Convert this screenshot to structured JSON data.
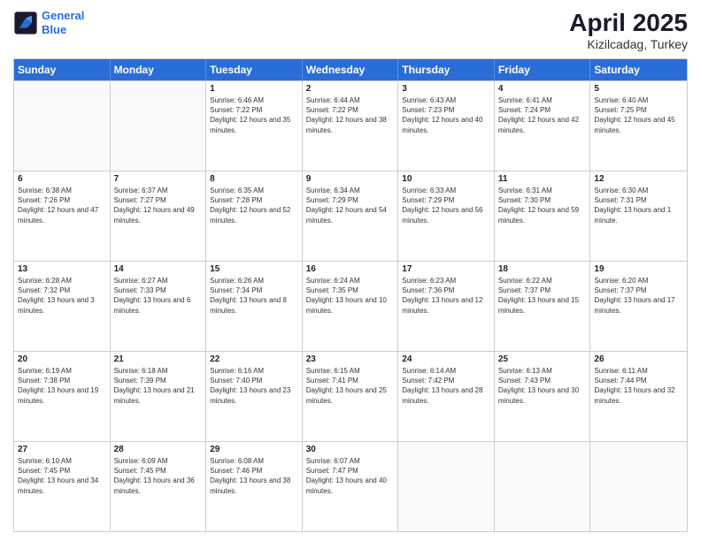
{
  "header": {
    "logo_line1": "General",
    "logo_line2": "Blue",
    "month": "April 2025",
    "location": "Kizilcadag, Turkey"
  },
  "days": [
    "Sunday",
    "Monday",
    "Tuesday",
    "Wednesday",
    "Thursday",
    "Friday",
    "Saturday"
  ],
  "weeks": [
    [
      {
        "day": "",
        "empty": true
      },
      {
        "day": "",
        "empty": true
      },
      {
        "num": "1",
        "line1": "Sunrise: 6:46 AM",
        "line2": "Sunset: 7:22 PM",
        "line3": "Daylight: 12 hours and 35 minutes."
      },
      {
        "num": "2",
        "line1": "Sunrise: 6:44 AM",
        "line2": "Sunset: 7:22 PM",
        "line3": "Daylight: 12 hours and 38 minutes."
      },
      {
        "num": "3",
        "line1": "Sunrise: 6:43 AM",
        "line2": "Sunset: 7:23 PM",
        "line3": "Daylight: 12 hours and 40 minutes."
      },
      {
        "num": "4",
        "line1": "Sunrise: 6:41 AM",
        "line2": "Sunset: 7:24 PM",
        "line3": "Daylight: 12 hours and 42 minutes."
      },
      {
        "num": "5",
        "line1": "Sunrise: 6:40 AM",
        "line2": "Sunset: 7:25 PM",
        "line3": "Daylight: 12 hours and 45 minutes."
      }
    ],
    [
      {
        "num": "6",
        "line1": "Sunrise: 6:38 AM",
        "line2": "Sunset: 7:26 PM",
        "line3": "Daylight: 12 hours and 47 minutes."
      },
      {
        "num": "7",
        "line1": "Sunrise: 6:37 AM",
        "line2": "Sunset: 7:27 PM",
        "line3": "Daylight: 12 hours and 49 minutes."
      },
      {
        "num": "8",
        "line1": "Sunrise: 6:35 AM",
        "line2": "Sunset: 7:28 PM",
        "line3": "Daylight: 12 hours and 52 minutes."
      },
      {
        "num": "9",
        "line1": "Sunrise: 6:34 AM",
        "line2": "Sunset: 7:29 PM",
        "line3": "Daylight: 12 hours and 54 minutes."
      },
      {
        "num": "10",
        "line1": "Sunrise: 6:33 AM",
        "line2": "Sunset: 7:29 PM",
        "line3": "Daylight: 12 hours and 56 minutes."
      },
      {
        "num": "11",
        "line1": "Sunrise: 6:31 AM",
        "line2": "Sunset: 7:30 PM",
        "line3": "Daylight: 12 hours and 59 minutes."
      },
      {
        "num": "12",
        "line1": "Sunrise: 6:30 AM",
        "line2": "Sunset: 7:31 PM",
        "line3": "Daylight: 13 hours and 1 minute."
      }
    ],
    [
      {
        "num": "13",
        "line1": "Sunrise: 6:28 AM",
        "line2": "Sunset: 7:32 PM",
        "line3": "Daylight: 13 hours and 3 minutes."
      },
      {
        "num": "14",
        "line1": "Sunrise: 6:27 AM",
        "line2": "Sunset: 7:33 PM",
        "line3": "Daylight: 13 hours and 6 minutes."
      },
      {
        "num": "15",
        "line1": "Sunrise: 6:26 AM",
        "line2": "Sunset: 7:34 PM",
        "line3": "Daylight: 13 hours and 8 minutes."
      },
      {
        "num": "16",
        "line1": "Sunrise: 6:24 AM",
        "line2": "Sunset: 7:35 PM",
        "line3": "Daylight: 13 hours and 10 minutes."
      },
      {
        "num": "17",
        "line1": "Sunrise: 6:23 AM",
        "line2": "Sunset: 7:36 PM",
        "line3": "Daylight: 13 hours and 12 minutes."
      },
      {
        "num": "18",
        "line1": "Sunrise: 6:22 AM",
        "line2": "Sunset: 7:37 PM",
        "line3": "Daylight: 13 hours and 15 minutes."
      },
      {
        "num": "19",
        "line1": "Sunrise: 6:20 AM",
        "line2": "Sunset: 7:37 PM",
        "line3": "Daylight: 13 hours and 17 minutes."
      }
    ],
    [
      {
        "num": "20",
        "line1": "Sunrise: 6:19 AM",
        "line2": "Sunset: 7:38 PM",
        "line3": "Daylight: 13 hours and 19 minutes."
      },
      {
        "num": "21",
        "line1": "Sunrise: 6:18 AM",
        "line2": "Sunset: 7:39 PM",
        "line3": "Daylight: 13 hours and 21 minutes."
      },
      {
        "num": "22",
        "line1": "Sunrise: 6:16 AM",
        "line2": "Sunset: 7:40 PM",
        "line3": "Daylight: 13 hours and 23 minutes."
      },
      {
        "num": "23",
        "line1": "Sunrise: 6:15 AM",
        "line2": "Sunset: 7:41 PM",
        "line3": "Daylight: 13 hours and 25 minutes."
      },
      {
        "num": "24",
        "line1": "Sunrise: 6:14 AM",
        "line2": "Sunset: 7:42 PM",
        "line3": "Daylight: 13 hours and 28 minutes."
      },
      {
        "num": "25",
        "line1": "Sunrise: 6:13 AM",
        "line2": "Sunset: 7:43 PM",
        "line3": "Daylight: 13 hours and 30 minutes."
      },
      {
        "num": "26",
        "line1": "Sunrise: 6:11 AM",
        "line2": "Sunset: 7:44 PM",
        "line3": "Daylight: 13 hours and 32 minutes."
      }
    ],
    [
      {
        "num": "27",
        "line1": "Sunrise: 6:10 AM",
        "line2": "Sunset: 7:45 PM",
        "line3": "Daylight: 13 hours and 34 minutes."
      },
      {
        "num": "28",
        "line1": "Sunrise: 6:09 AM",
        "line2": "Sunset: 7:45 PM",
        "line3": "Daylight: 13 hours and 36 minutes."
      },
      {
        "num": "29",
        "line1": "Sunrise: 6:08 AM",
        "line2": "Sunset: 7:46 PM",
        "line3": "Daylight: 13 hours and 38 minutes."
      },
      {
        "num": "30",
        "line1": "Sunrise: 6:07 AM",
        "line2": "Sunset: 7:47 PM",
        "line3": "Daylight: 13 hours and 40 minutes."
      },
      {
        "day": "",
        "empty": true
      },
      {
        "day": "",
        "empty": true
      },
      {
        "day": "",
        "empty": true
      }
    ]
  ]
}
